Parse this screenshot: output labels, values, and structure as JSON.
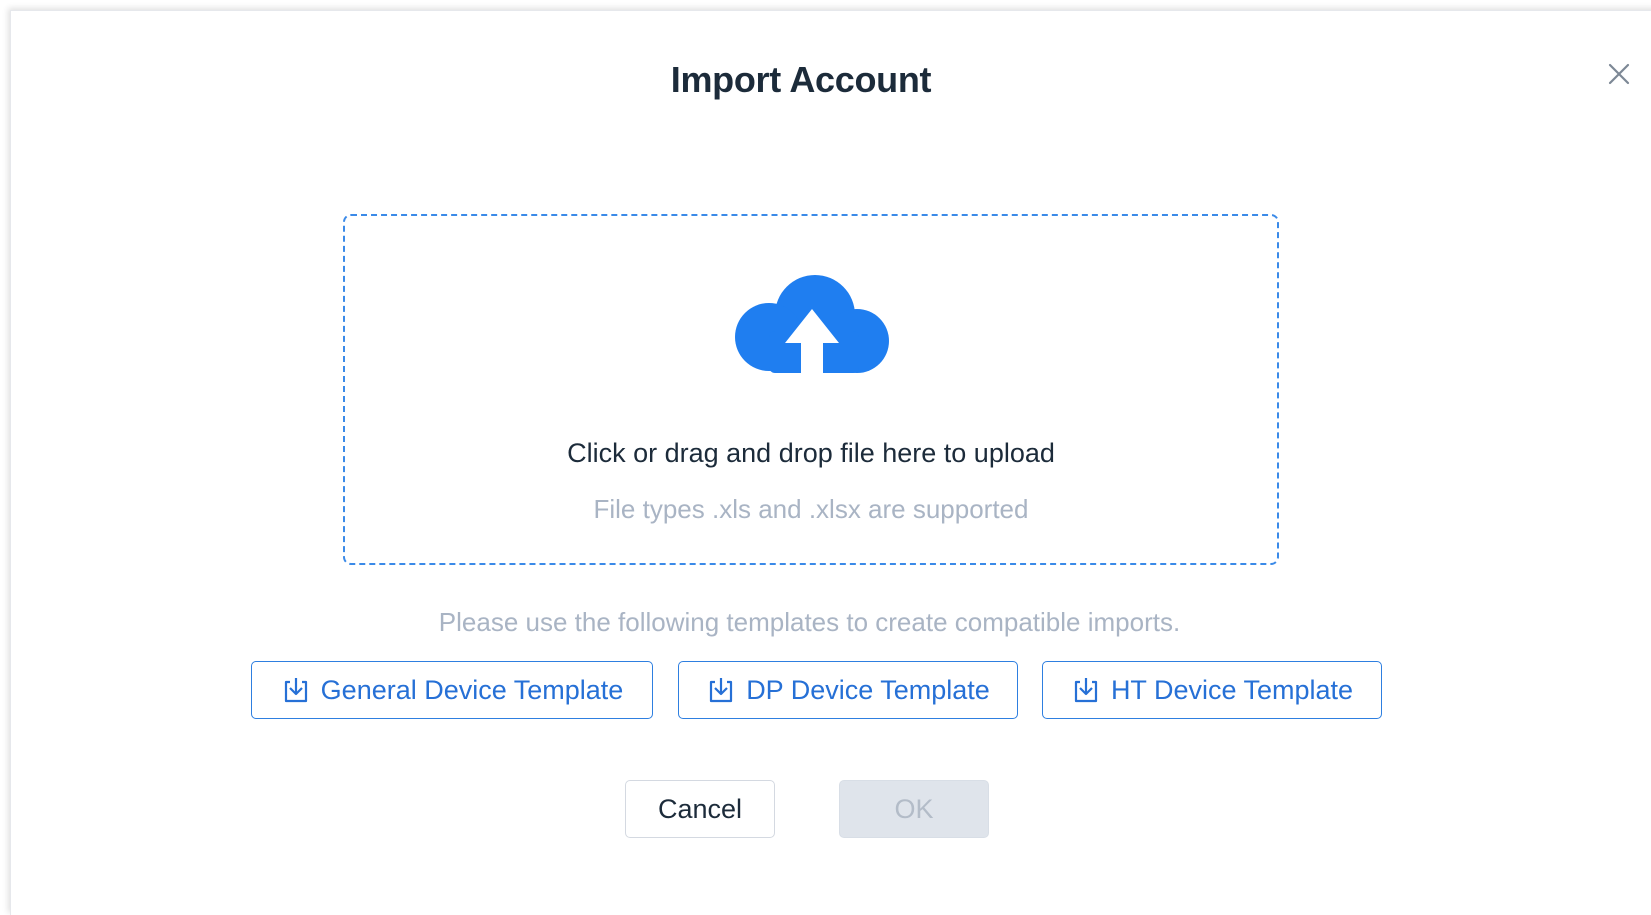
{
  "dialog": {
    "title": "Import Account",
    "close_icon": "close-icon"
  },
  "dropzone": {
    "icon": "cloud-upload-icon",
    "main_text": "Click or drag and drop file here to upload",
    "sub_text": "File types .xls and .xlsx are supported",
    "accent_color": "#3b8ae8"
  },
  "templates": {
    "hint": "Please use the following templates to create compatible imports.",
    "buttons": [
      {
        "label": "General Device Template",
        "icon": "download-icon"
      },
      {
        "label": "DP Device Template",
        "icon": "download-icon"
      },
      {
        "label": "HT Device Template",
        "icon": "download-icon"
      }
    ]
  },
  "footer": {
    "cancel_label": "Cancel",
    "ok_label": "OK"
  },
  "colors": {
    "primary": "#2670d6",
    "title": "#1c2b3a",
    "muted": "#a9b4c4",
    "disabled_bg": "#dfe4eb"
  }
}
